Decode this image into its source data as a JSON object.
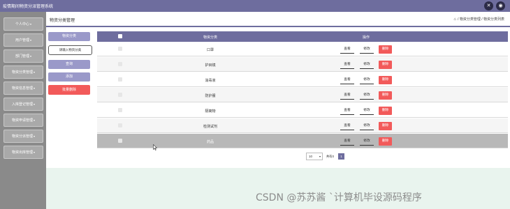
{
  "app": {
    "title": "疫情期间物资分派管理系统"
  },
  "topbar": {
    "settings_icon": "✕",
    "user_icon": "◉"
  },
  "sidebar": {
    "items": [
      {
        "label": "个人中心"
      },
      {
        "label": "用户管理"
      },
      {
        "label": "部门管理"
      },
      {
        "label": "物资分类管理"
      },
      {
        "label": "物资信息管理"
      },
      {
        "label": "入库登记管理"
      },
      {
        "label": "物资申请管理"
      },
      {
        "label": "物资分派管理"
      },
      {
        "label": "物资出库管理"
      }
    ],
    "chevron": "▾"
  },
  "header": {
    "title": "物资分类管理",
    "breadcrumb": "/ 物资分类管理 / 物资分类列表",
    "home_icon": "⌂"
  },
  "controls": {
    "category_label": "物资分类",
    "search_placeholder": "请输入物资分类",
    "query_label": "查询",
    "add_label": "添加",
    "batch_delete_label": "批量删除"
  },
  "table": {
    "headers": {
      "name": "物资分类",
      "ops": "操作"
    },
    "rows": [
      {
        "name": "口罩"
      },
      {
        "name": "护目镜"
      },
      {
        "name": "消毒液"
      },
      {
        "name": "防护服"
      },
      {
        "name": "隔离物"
      },
      {
        "name": "检测试剂"
      },
      {
        "name": "药品"
      }
    ],
    "op_labels": {
      "view": "查看",
      "edit": "修改",
      "delete": "删除"
    }
  },
  "pager": {
    "page_size": "10",
    "total_label": "共有0",
    "current_page": "1"
  },
  "watermark": "CSDN @苏苏酱   `计算机毕设源码程序",
  "colors": {
    "primary": "#6e6d9e",
    "danger": "#f25a5a",
    "sidebar": "#8a8a8a"
  }
}
